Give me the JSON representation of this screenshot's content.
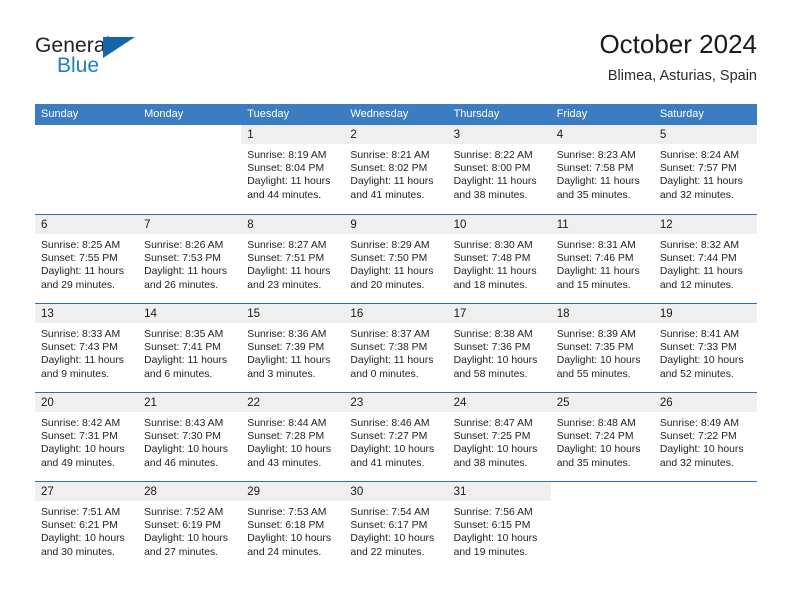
{
  "brand": {
    "name_part1": "General",
    "name_part2": "Blue",
    "accent_color": "#1565a8",
    "text_color": "#231f20"
  },
  "header": {
    "title": "October 2024",
    "location": "Blimea, Asturias, Spain"
  },
  "theme": {
    "header_row_color": "#3b7dc0",
    "row_divider_color": "#2f6fb0",
    "day_banner_color": "#efefef",
    "page_background": "#ffffff"
  },
  "weekdays": [
    "Sunday",
    "Monday",
    "Tuesday",
    "Wednesday",
    "Thursday",
    "Friday",
    "Saturday"
  ],
  "weeks": [
    [
      {
        "day": "",
        "sunrise": "",
        "sunset": "",
        "daylight_line1": "",
        "daylight_line2": ""
      },
      {
        "day": "",
        "sunrise": "",
        "sunset": "",
        "daylight_line1": "",
        "daylight_line2": ""
      },
      {
        "day": "1",
        "sunrise": "Sunrise: 8:19 AM",
        "sunset": "Sunset: 8:04 PM",
        "daylight_line1": "Daylight: 11 hours",
        "daylight_line2": "and 44 minutes."
      },
      {
        "day": "2",
        "sunrise": "Sunrise: 8:21 AM",
        "sunset": "Sunset: 8:02 PM",
        "daylight_line1": "Daylight: 11 hours",
        "daylight_line2": "and 41 minutes."
      },
      {
        "day": "3",
        "sunrise": "Sunrise: 8:22 AM",
        "sunset": "Sunset: 8:00 PM",
        "daylight_line1": "Daylight: 11 hours",
        "daylight_line2": "and 38 minutes."
      },
      {
        "day": "4",
        "sunrise": "Sunrise: 8:23 AM",
        "sunset": "Sunset: 7:58 PM",
        "daylight_line1": "Daylight: 11 hours",
        "daylight_line2": "and 35 minutes."
      },
      {
        "day": "5",
        "sunrise": "Sunrise: 8:24 AM",
        "sunset": "Sunset: 7:57 PM",
        "daylight_line1": "Daylight: 11 hours",
        "daylight_line2": "and 32 minutes."
      }
    ],
    [
      {
        "day": "6",
        "sunrise": "Sunrise: 8:25 AM",
        "sunset": "Sunset: 7:55 PM",
        "daylight_line1": "Daylight: 11 hours",
        "daylight_line2": "and 29 minutes."
      },
      {
        "day": "7",
        "sunrise": "Sunrise: 8:26 AM",
        "sunset": "Sunset: 7:53 PM",
        "daylight_line1": "Daylight: 11 hours",
        "daylight_line2": "and 26 minutes."
      },
      {
        "day": "8",
        "sunrise": "Sunrise: 8:27 AM",
        "sunset": "Sunset: 7:51 PM",
        "daylight_line1": "Daylight: 11 hours",
        "daylight_line2": "and 23 minutes."
      },
      {
        "day": "9",
        "sunrise": "Sunrise: 8:29 AM",
        "sunset": "Sunset: 7:50 PM",
        "daylight_line1": "Daylight: 11 hours",
        "daylight_line2": "and 20 minutes."
      },
      {
        "day": "10",
        "sunrise": "Sunrise: 8:30 AM",
        "sunset": "Sunset: 7:48 PM",
        "daylight_line1": "Daylight: 11 hours",
        "daylight_line2": "and 18 minutes."
      },
      {
        "day": "11",
        "sunrise": "Sunrise: 8:31 AM",
        "sunset": "Sunset: 7:46 PM",
        "daylight_line1": "Daylight: 11 hours",
        "daylight_line2": "and 15 minutes."
      },
      {
        "day": "12",
        "sunrise": "Sunrise: 8:32 AM",
        "sunset": "Sunset: 7:44 PM",
        "daylight_line1": "Daylight: 11 hours",
        "daylight_line2": "and 12 minutes."
      }
    ],
    [
      {
        "day": "13",
        "sunrise": "Sunrise: 8:33 AM",
        "sunset": "Sunset: 7:43 PM",
        "daylight_line1": "Daylight: 11 hours",
        "daylight_line2": "and 9 minutes."
      },
      {
        "day": "14",
        "sunrise": "Sunrise: 8:35 AM",
        "sunset": "Sunset: 7:41 PM",
        "daylight_line1": "Daylight: 11 hours",
        "daylight_line2": "and 6 minutes."
      },
      {
        "day": "15",
        "sunrise": "Sunrise: 8:36 AM",
        "sunset": "Sunset: 7:39 PM",
        "daylight_line1": "Daylight: 11 hours",
        "daylight_line2": "and 3 minutes."
      },
      {
        "day": "16",
        "sunrise": "Sunrise: 8:37 AM",
        "sunset": "Sunset: 7:38 PM",
        "daylight_line1": "Daylight: 11 hours",
        "daylight_line2": "and 0 minutes."
      },
      {
        "day": "17",
        "sunrise": "Sunrise: 8:38 AM",
        "sunset": "Sunset: 7:36 PM",
        "daylight_line1": "Daylight: 10 hours",
        "daylight_line2": "and 58 minutes."
      },
      {
        "day": "18",
        "sunrise": "Sunrise: 8:39 AM",
        "sunset": "Sunset: 7:35 PM",
        "daylight_line1": "Daylight: 10 hours",
        "daylight_line2": "and 55 minutes."
      },
      {
        "day": "19",
        "sunrise": "Sunrise: 8:41 AM",
        "sunset": "Sunset: 7:33 PM",
        "daylight_line1": "Daylight: 10 hours",
        "daylight_line2": "and 52 minutes."
      }
    ],
    [
      {
        "day": "20",
        "sunrise": "Sunrise: 8:42 AM",
        "sunset": "Sunset: 7:31 PM",
        "daylight_line1": "Daylight: 10 hours",
        "daylight_line2": "and 49 minutes."
      },
      {
        "day": "21",
        "sunrise": "Sunrise: 8:43 AM",
        "sunset": "Sunset: 7:30 PM",
        "daylight_line1": "Daylight: 10 hours",
        "daylight_line2": "and 46 minutes."
      },
      {
        "day": "22",
        "sunrise": "Sunrise: 8:44 AM",
        "sunset": "Sunset: 7:28 PM",
        "daylight_line1": "Daylight: 10 hours",
        "daylight_line2": "and 43 minutes."
      },
      {
        "day": "23",
        "sunrise": "Sunrise: 8:46 AM",
        "sunset": "Sunset: 7:27 PM",
        "daylight_line1": "Daylight: 10 hours",
        "daylight_line2": "and 41 minutes."
      },
      {
        "day": "24",
        "sunrise": "Sunrise: 8:47 AM",
        "sunset": "Sunset: 7:25 PM",
        "daylight_line1": "Daylight: 10 hours",
        "daylight_line2": "and 38 minutes."
      },
      {
        "day": "25",
        "sunrise": "Sunrise: 8:48 AM",
        "sunset": "Sunset: 7:24 PM",
        "daylight_line1": "Daylight: 10 hours",
        "daylight_line2": "and 35 minutes."
      },
      {
        "day": "26",
        "sunrise": "Sunrise: 8:49 AM",
        "sunset": "Sunset: 7:22 PM",
        "daylight_line1": "Daylight: 10 hours",
        "daylight_line2": "and 32 minutes."
      }
    ],
    [
      {
        "day": "27",
        "sunrise": "Sunrise: 7:51 AM",
        "sunset": "Sunset: 6:21 PM",
        "daylight_line1": "Daylight: 10 hours",
        "daylight_line2": "and 30 minutes."
      },
      {
        "day": "28",
        "sunrise": "Sunrise: 7:52 AM",
        "sunset": "Sunset: 6:19 PM",
        "daylight_line1": "Daylight: 10 hours",
        "daylight_line2": "and 27 minutes."
      },
      {
        "day": "29",
        "sunrise": "Sunrise: 7:53 AM",
        "sunset": "Sunset: 6:18 PM",
        "daylight_line1": "Daylight: 10 hours",
        "daylight_line2": "and 24 minutes."
      },
      {
        "day": "30",
        "sunrise": "Sunrise: 7:54 AM",
        "sunset": "Sunset: 6:17 PM",
        "daylight_line1": "Daylight: 10 hours",
        "daylight_line2": "and 22 minutes."
      },
      {
        "day": "31",
        "sunrise": "Sunrise: 7:56 AM",
        "sunset": "Sunset: 6:15 PM",
        "daylight_line1": "Daylight: 10 hours",
        "daylight_line2": "and 19 minutes."
      },
      {
        "day": "",
        "sunrise": "",
        "sunset": "",
        "daylight_line1": "",
        "daylight_line2": ""
      },
      {
        "day": "",
        "sunrise": "",
        "sunset": "",
        "daylight_line1": "",
        "daylight_line2": ""
      }
    ]
  ]
}
